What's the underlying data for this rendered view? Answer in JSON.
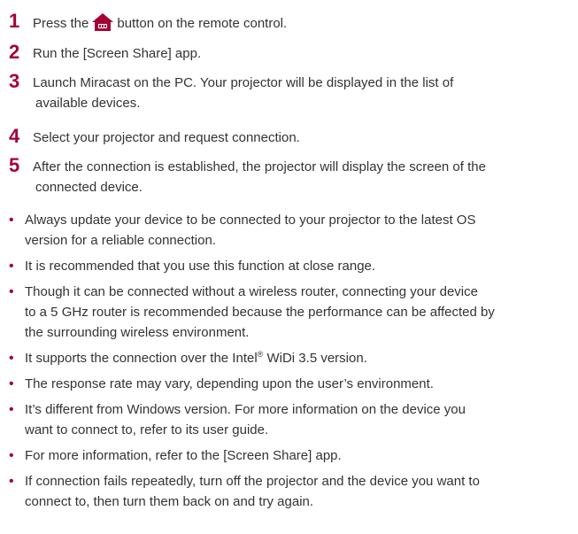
{
  "steps": [
    {
      "number": "1",
      "text_before": "Press the",
      "icon": "home-icon",
      "text_after": "button on the remote control."
    },
    {
      "number": "2",
      "text": "Run the [Screen Share] app."
    },
    {
      "number": "3",
      "line1": "Launch Miracast on the PC. Your projector will be displayed in the list of",
      "line2": "available devices."
    },
    {
      "number": "4",
      "text": "Select your projector and request connection."
    },
    {
      "number": "5",
      "line1": "After the connection is established, the projector will display the screen of the",
      "line2": "connected device."
    }
  ],
  "bullet_symbol": "•",
  "bullets": [
    {
      "line1": "Always update your device to be connected to your projector to the latest OS",
      "line2": "version for a reliable connection."
    },
    {
      "line1": "It is recommended that you use this function at close range."
    },
    {
      "line1": "Though it can be connected without a wireless router, connecting your device",
      "line2": "to a 5 GHz router is recommended because the performance can be affected by",
      "line3": "the surrounding wireless environment."
    },
    {
      "before": "It supports the connection over the Intel",
      "sup": "®",
      "after": " WiDi 3.5 version."
    },
    {
      "line1": "The response rate may vary, depending upon the user’s environment."
    },
    {
      "line1": "It’s different from Windows version. For more information on the device you",
      "line2": "want to connect to, refer to its user guide."
    },
    {
      "line1": "For more information, refer to the [Screen Share] app."
    },
    {
      "line1": "If connection fails repeatedly, turn off the projector and the device you want to",
      "line2": "connect to, then turn them back on and try again."
    }
  ],
  "colors": {
    "accent": "#a50034",
    "text": "#333333"
  }
}
